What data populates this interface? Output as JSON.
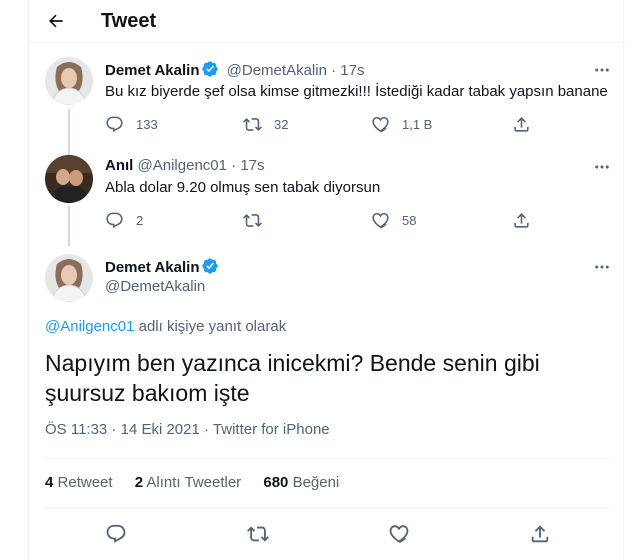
{
  "header": {
    "title": "Tweet"
  },
  "colors": {
    "accent": "#1d9bf0",
    "muted": "#536471",
    "text": "#0f1419",
    "border": "#eff3f4"
  },
  "tweets": [
    {
      "name": "Demet Akalin",
      "handle": "@DemetAkalin",
      "time": "17s",
      "sep": "·",
      "text": "Bu kız biyerde şef olsa kimse gitmezki!!! İstediği kadar tabak yapsın banane",
      "replies": "133",
      "retweets": "32",
      "likes": "1,1 B"
    },
    {
      "name": "Anıl",
      "handle": "@Anilgenc01",
      "time": "17s",
      "sep": "·",
      "text": "Abla dolar 9.20 olmuş sen tabak diyorsun",
      "replies": "2",
      "retweets": "",
      "likes": "58"
    }
  ],
  "main": {
    "name": "Demet Akalin",
    "handle": "@DemetAkalin",
    "reply_mention": "@Anilgenc01",
    "reply_suffix": " adlı kişiye yanıt olarak",
    "text_line1": "Napıyım ben yazınca inicekmi? Bende senin gibi",
    "text_line2": "şuursuz bakıom işte",
    "time": "ÖS 11:33",
    "date": "14 Eki 2021",
    "source": "Twitter for iPhone",
    "sep": " · ",
    "stats": {
      "retweets_count": "4",
      "retweets_label": "Retweet",
      "quotes_count": "2",
      "quotes_label": "Alıntı Tweetler",
      "likes_count": "680",
      "likes_label": "Beğeni"
    }
  },
  "icons": [
    "back-arrow-icon",
    "verified-badge-icon",
    "more-icon",
    "reply-icon",
    "retweet-icon",
    "like-icon",
    "share-icon"
  ]
}
